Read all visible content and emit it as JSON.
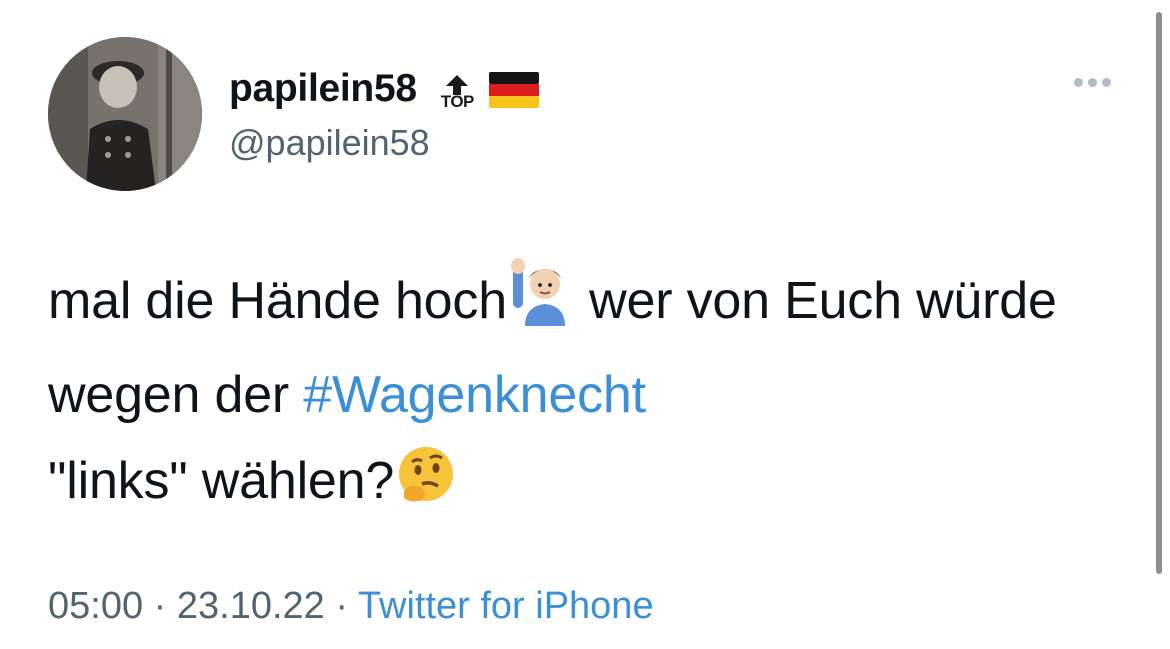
{
  "author": {
    "display_name": "papilein58",
    "badge_label": "TOP",
    "badge_icon": "top-arrow-icon",
    "flag_icon": "germany-flag-icon",
    "handle": "@papilein58"
  },
  "tweet": {
    "text_part1": "mal die Hände hoch",
    "emoji1": "man-raising-hand-icon",
    "text_part2": " wer von Euch würde wegen der ",
    "hashtag": "#Wagenknecht",
    "text_part3": " \"links\" wählen?",
    "emoji2": "thinking-face-icon"
  },
  "meta": {
    "time": "05:00",
    "separator": " · ",
    "date": "23.10.22",
    "source": "Twitter for iPhone"
  },
  "colors": {
    "link": "#3b8fd6",
    "text": "#0f1419",
    "muted": "#536471"
  }
}
